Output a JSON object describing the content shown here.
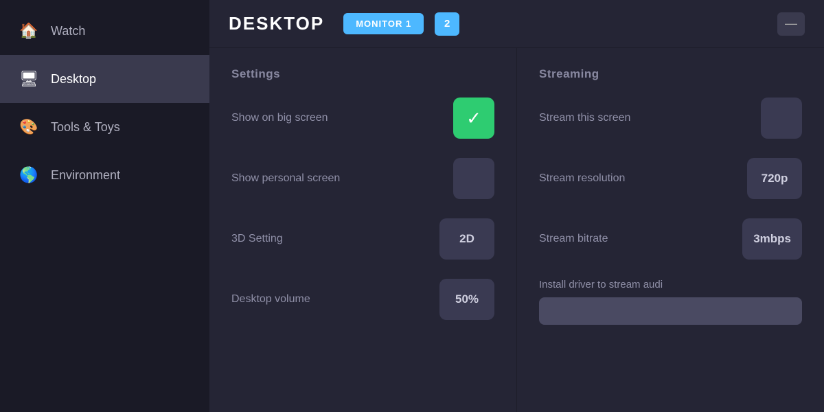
{
  "sidebar": {
    "items": [
      {
        "id": "watch",
        "label": "Watch",
        "icon": "🏠",
        "active": false
      },
      {
        "id": "desktop",
        "label": "Desktop",
        "icon": "🖥",
        "active": true
      },
      {
        "id": "tools",
        "label": "Tools & Toys",
        "icon": "🎨",
        "active": false
      },
      {
        "id": "environment",
        "label": "Environment",
        "icon": "🌎",
        "active": false
      }
    ]
  },
  "header": {
    "title": "DESKTOP",
    "monitor1_label": "MONITOR 1",
    "monitor2_label": "2",
    "minimize_icon": "—"
  },
  "settings": {
    "section_title": "Settings",
    "rows": [
      {
        "id": "show-big-screen",
        "label": "Show on big screen",
        "value": "checked",
        "display": "✓"
      },
      {
        "id": "show-personal-screen",
        "label": "Show personal screen",
        "value": "unchecked",
        "display": ""
      },
      {
        "id": "3d-setting",
        "label": "3D Setting",
        "value": "2D",
        "display": "2D"
      },
      {
        "id": "desktop-volume",
        "label": "Desktop volume",
        "value": "50%",
        "display": "50%"
      }
    ]
  },
  "streaming": {
    "section_title": "Streaming",
    "rows": [
      {
        "id": "stream-this-screen",
        "label": "Stream this screen",
        "value": "unchecked"
      },
      {
        "id": "stream-resolution",
        "label": "Stream resolution",
        "value": "720p"
      },
      {
        "id": "stream-bitrate",
        "label": "Stream bitrate",
        "value": "3mbps"
      }
    ],
    "install_label": "Install driver to stream audi",
    "install_btn_label": ""
  }
}
